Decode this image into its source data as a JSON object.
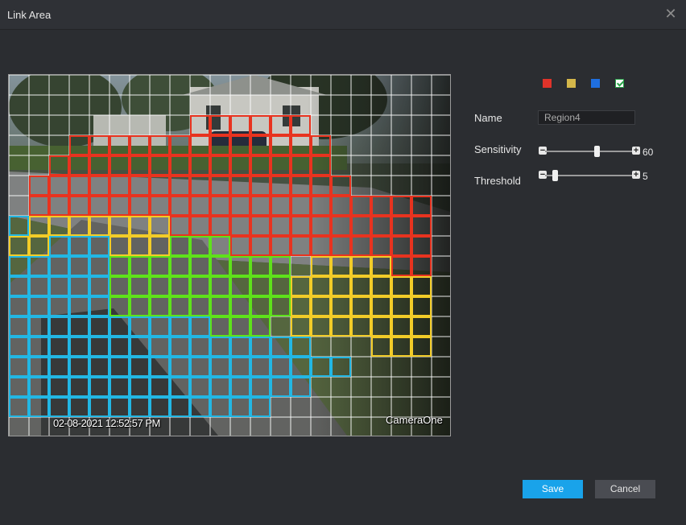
{
  "dialog": {
    "title": "Link Area",
    "close_icon": "close-icon"
  },
  "video": {
    "timestamp": "02-08-2021 12:52:57 PM",
    "camera_name": "CameraOne"
  },
  "region_colors": [
    "#e0332a",
    "#d4b74a",
    "#1f6fe0",
    "#2aa34a"
  ],
  "grid": {
    "cols": 22,
    "rows": 18,
    "regions": [
      {
        "color": "#e8331f",
        "rows": [
          [
            2,
            9,
            14
          ],
          [
            3,
            3,
            15
          ],
          [
            4,
            2,
            15
          ],
          [
            5,
            1,
            16
          ],
          [
            6,
            1,
            21
          ],
          [
            7,
            8,
            21
          ],
          [
            8,
            8,
            21
          ],
          [
            9,
            19,
            21
          ],
          [
            10,
            19,
            21
          ]
        ]
      },
      {
        "color": "#f2cc28",
        "rows": [
          [
            7,
            0,
            7
          ],
          [
            8,
            0,
            1
          ],
          [
            8,
            5,
            7
          ],
          [
            9,
            15,
            18
          ],
          [
            10,
            14,
            21
          ],
          [
            11,
            14,
            21
          ],
          [
            12,
            14,
            21
          ],
          [
            13,
            18,
            21
          ]
        ]
      },
      {
        "color": "#22b7e4",
        "rows": [
          [
            7,
            0,
            0
          ],
          [
            8,
            2,
            4
          ],
          [
            9,
            0,
            4
          ],
          [
            10,
            0,
            4
          ],
          [
            11,
            0,
            4
          ],
          [
            12,
            0,
            9
          ],
          [
            13,
            0,
            14
          ],
          [
            14,
            0,
            16
          ],
          [
            15,
            0,
            14
          ],
          [
            16,
            0,
            12
          ],
          [
            17,
            0,
            11
          ],
          [
            18,
            0,
            11
          ],
          [
            19,
            0,
            11
          ],
          [
            20,
            0,
            11
          ]
        ]
      },
      {
        "color": "#5ee21a",
        "rows": [
          [
            8,
            8,
            10
          ],
          [
            9,
            5,
            13
          ],
          [
            10,
            5,
            13
          ],
          [
            11,
            5,
            13
          ],
          [
            12,
            10,
            12
          ]
        ]
      }
    ]
  },
  "form": {
    "name_label": "Name",
    "name_value": "Region4",
    "sensitivity_label": "Sensitivity",
    "sensitivity_value": "60",
    "sensitivity_fraction": 0.6,
    "threshold_label": "Threshold",
    "threshold_value": "5",
    "threshold_fraction": 0.05
  },
  "buttons": {
    "save": "Save",
    "cancel": "Cancel"
  }
}
